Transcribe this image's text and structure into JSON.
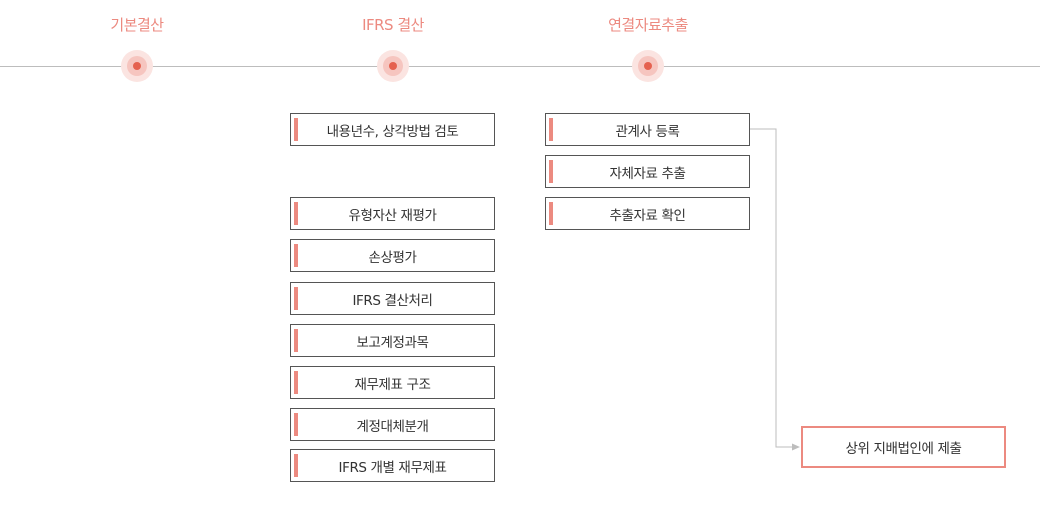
{
  "colors": {
    "accent": "#ec8a80",
    "accent_light": "#fbe4e1",
    "accent_mid": "#f6c5bf",
    "accent_dark": "#e5614f",
    "line": "#bdbdbd",
    "border": "#555555"
  },
  "phases": [
    {
      "label": "기본결산"
    },
    {
      "label": "IFRS 결산"
    },
    {
      "label": "연결자료추출"
    }
  ],
  "ifrs_steps": [
    {
      "label": "내용년수, 상각방법 검토"
    },
    {
      "label": "유형자산 재평가"
    },
    {
      "label": "손상평가"
    },
    {
      "label": "IFRS 결산처리"
    },
    {
      "label": "보고계정과목"
    },
    {
      "label": "재무제표 구조"
    },
    {
      "label": "계정대체분개"
    },
    {
      "label": "IFRS 개별 재무제표"
    }
  ],
  "consolidation_steps": [
    {
      "label": "관계사 등록"
    },
    {
      "label": "자체자료 추출"
    },
    {
      "label": "추출자료 확인"
    }
  ],
  "final_step": {
    "label": "상위 지배법인에 제출"
  }
}
